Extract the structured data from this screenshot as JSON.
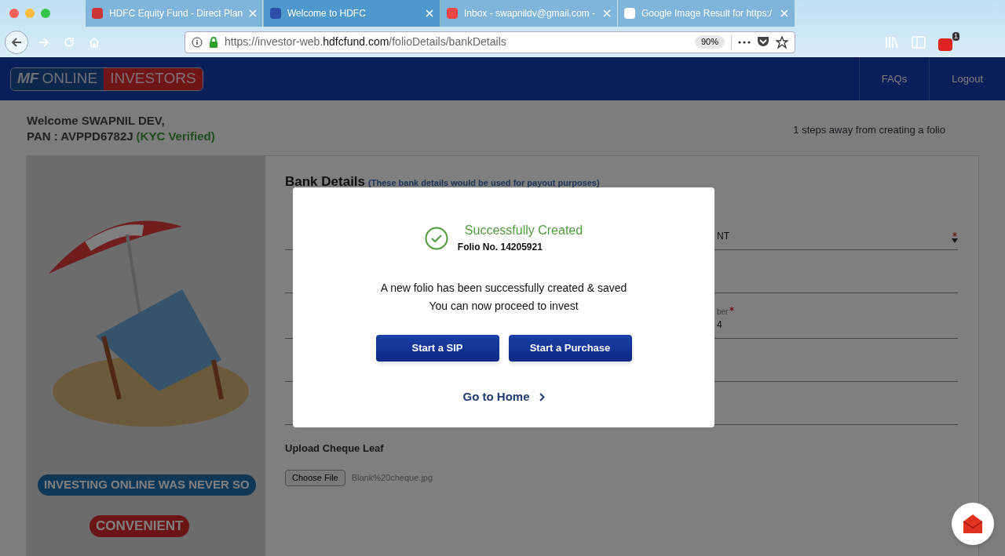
{
  "browser": {
    "tabs": [
      {
        "title": "HDFC Equity Fund - Direct Plan",
        "selected": false
      },
      {
        "title": "Welcome to HDFC",
        "selected": true
      },
      {
        "title": "Inbox - swapnildv@gmail.com -",
        "selected": false
      },
      {
        "title": "Google Image Result for https:/",
        "selected": false
      }
    ],
    "url": {
      "prefix": "https://investor-web.",
      "domain": "hdfcfund.com",
      "path": "/folioDetails/bankDetails"
    },
    "zoom": "90%",
    "extension_badge": "1"
  },
  "header": {
    "logo_parts": [
      "MF",
      "ONLINE",
      "INVESTORS"
    ],
    "nav": [
      "FAQs",
      "Logout"
    ]
  },
  "welcome": {
    "greeting": "Welcome SWAPNIL DEV,",
    "pan": "PAN : AVPPD6782J",
    "kyc": "(KYC Verified)",
    "steps": "1 steps away from creating a folio"
  },
  "banner": {
    "lines": [
      "INVESTING ONLINE WAS NEVER SO",
      "CONVENIENT"
    ]
  },
  "form": {
    "title": "Bank Details",
    "note": "(These bank details would be used for payout purposes)",
    "rows": [
      {
        "right_value": "NT",
        "required": true
      },
      {},
      {
        "right_label": "ber",
        "right_value": "4",
        "required": true
      },
      {},
      {}
    ],
    "upload_label": "Upload Cheque Leaf",
    "file_button": "Choose File",
    "file_name": "Blank%20cheque.jpg"
  },
  "modal": {
    "title": "Successfully Created",
    "folio": "Folio No. 14205921",
    "message": [
      "A new folio has been successfully created & saved",
      "You can now proceed to invest"
    ],
    "buttons": [
      "Start a SIP",
      "Start a Purchase"
    ],
    "link": "Go to Home"
  }
}
